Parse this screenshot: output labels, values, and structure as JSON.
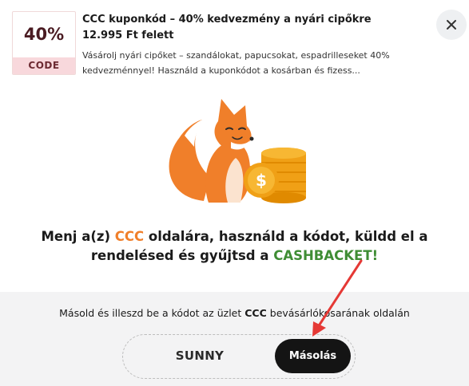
{
  "offer": {
    "badge_value": "40%",
    "badge_label": "CODE",
    "title": "CCC kuponkód – 40% kedvezmény a nyári cipőkre 12.995 Ft felett",
    "description": "Vásárolj nyári cipőket – szandálokat, papucsokat, espadrilleseket 40% kedvezménnyel! Használd a kuponkódot a kosárban és fizess..."
  },
  "close": {
    "icon": "close-icon"
  },
  "headline": {
    "part1": "Menj a(z) ",
    "store": "CCC",
    "part2": " oldalára, használd a kódot, küldd el a rendelésed és gyűjtsd a ",
    "cashback": "CASHBACKET!"
  },
  "instruction": {
    "part1": "Másold és illeszd be a kódot az üzlet ",
    "store": "CCC",
    "part2": " bevásárlókosarának oldalán"
  },
  "coupon": {
    "code": "SUNNY",
    "copy_label": "Másolás"
  },
  "colors": {
    "accent_orange": "#f07f2a",
    "cashback_green": "#3f8d34",
    "badge_pink": "#f8d8dc",
    "copy_button": "#141414",
    "annotation_arrow": "#e53935"
  }
}
